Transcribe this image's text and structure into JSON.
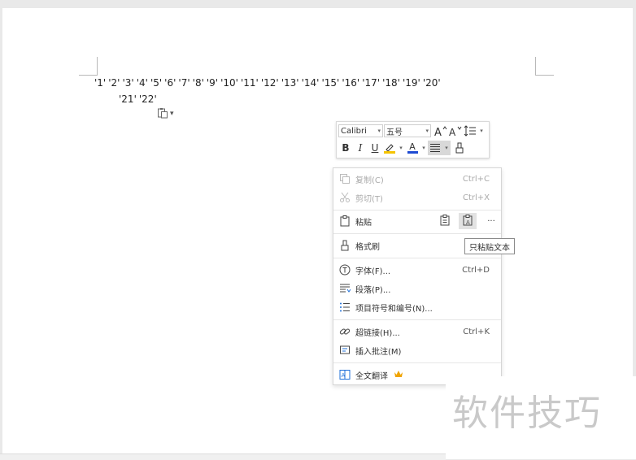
{
  "document": {
    "line1": [
      "'1'",
      "'2'",
      "'3'",
      "'4'",
      "'5'",
      "'6'",
      "'7'",
      "'8'",
      "'9'",
      "'10'",
      "'11'",
      "'12'",
      "'13'",
      "'14'",
      "'15'",
      "'16'",
      "'17'",
      "'18'",
      "'19'",
      "'20'"
    ],
    "line2": [
      "'21'",
      "'22'"
    ]
  },
  "mini_toolbar": {
    "font_name": "Calibri",
    "font_size": "五号",
    "icons": [
      "increase-font-icon",
      "decrease-font-icon",
      "line-spacing-icon",
      "bold-icon",
      "italic-icon",
      "underline-icon",
      "highlight-icon",
      "font-color-icon",
      "align-icon",
      "format-painter-icon"
    ],
    "bold": "B",
    "italic": "I",
    "underline": "U",
    "font_color_letter": "A",
    "highlight_color": "#f5c400",
    "font_color": "#1e4bd2"
  },
  "context_menu": {
    "copy": {
      "label": "复制(C)",
      "shortcut": "Ctrl+C",
      "enabled": false
    },
    "cut": {
      "label": "剪切(T)",
      "shortcut": "Ctrl+X",
      "enabled": false
    },
    "paste": {
      "label": "粘贴",
      "more": "···"
    },
    "format_painter": {
      "label": "格式刷"
    },
    "font": {
      "label": "字体(F)...",
      "shortcut": "Ctrl+D"
    },
    "paragraph": {
      "label": "段落(P)..."
    },
    "bullets": {
      "label": "项目符号和编号(N)..."
    },
    "hyperlink": {
      "label": "超链接(H)...",
      "shortcut": "Ctrl+K"
    },
    "comment": {
      "label": "插入批注(M)"
    },
    "translate": {
      "label": "全文翻译"
    }
  },
  "tooltip": "只粘贴文本",
  "watermark": "软件技巧",
  "colors": {
    "accent_crown": "#f0a400",
    "tooltip_border": "#8a8a8a"
  }
}
